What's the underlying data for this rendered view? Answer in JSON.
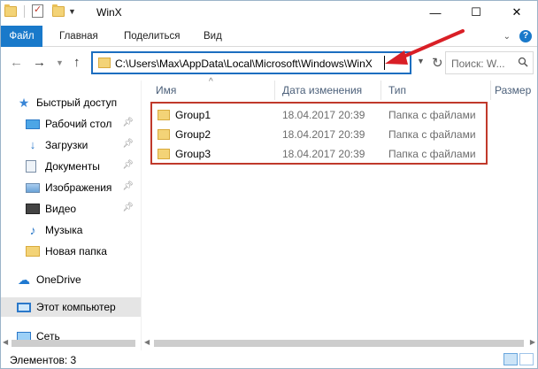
{
  "window": {
    "title": "WinX"
  },
  "titlebar": {
    "minimize": "—",
    "maximize": "☐",
    "close": "✕"
  },
  "ribbon": {
    "tabs": [
      "Файл",
      "Главная",
      "Поделиться",
      "Вид"
    ]
  },
  "address": {
    "path": "C:\\Users\\Max\\AppData\\Local\\Microsoft\\Windows\\WinX",
    "search_placeholder": "Поиск: W..."
  },
  "nav": {
    "items": [
      {
        "label": "Быстрый доступ",
        "icon": "star-icon",
        "pinned": false
      },
      {
        "label": "Рабочий стол",
        "icon": "desktop-icon",
        "pinned": true
      },
      {
        "label": "Загрузки",
        "icon": "downloads-icon",
        "pinned": true
      },
      {
        "label": "Документы",
        "icon": "documents-icon",
        "pinned": true
      },
      {
        "label": "Изображения",
        "icon": "pictures-icon",
        "pinned": true
      },
      {
        "label": "Видео",
        "icon": "video-icon",
        "pinned": true
      },
      {
        "label": "Музыка",
        "icon": "music-icon",
        "pinned": false
      },
      {
        "label": "Новая папка",
        "icon": "folder-icon",
        "pinned": false
      },
      {
        "label": "OneDrive",
        "icon": "cloud-icon",
        "pinned": false
      },
      {
        "label": "Этот компьютер",
        "icon": "computer-icon",
        "pinned": false
      },
      {
        "label": "Сеть",
        "icon": "network-icon",
        "pinned": false
      }
    ]
  },
  "columns": [
    "Имя",
    "Дата изменения",
    "Тип",
    "Размер"
  ],
  "files": [
    {
      "name": "Group1",
      "date": "18.04.2017 20:39",
      "type": "Папка с файлами"
    },
    {
      "name": "Group2",
      "date": "18.04.2017 20:39",
      "type": "Папка с файлами"
    },
    {
      "name": "Group3",
      "date": "18.04.2017 20:39",
      "type": "Папка с файлами"
    }
  ],
  "status": {
    "text": "Элементов: 3"
  },
  "colors": {
    "accent": "#1979ca",
    "annotation_red": "#c0392b"
  }
}
